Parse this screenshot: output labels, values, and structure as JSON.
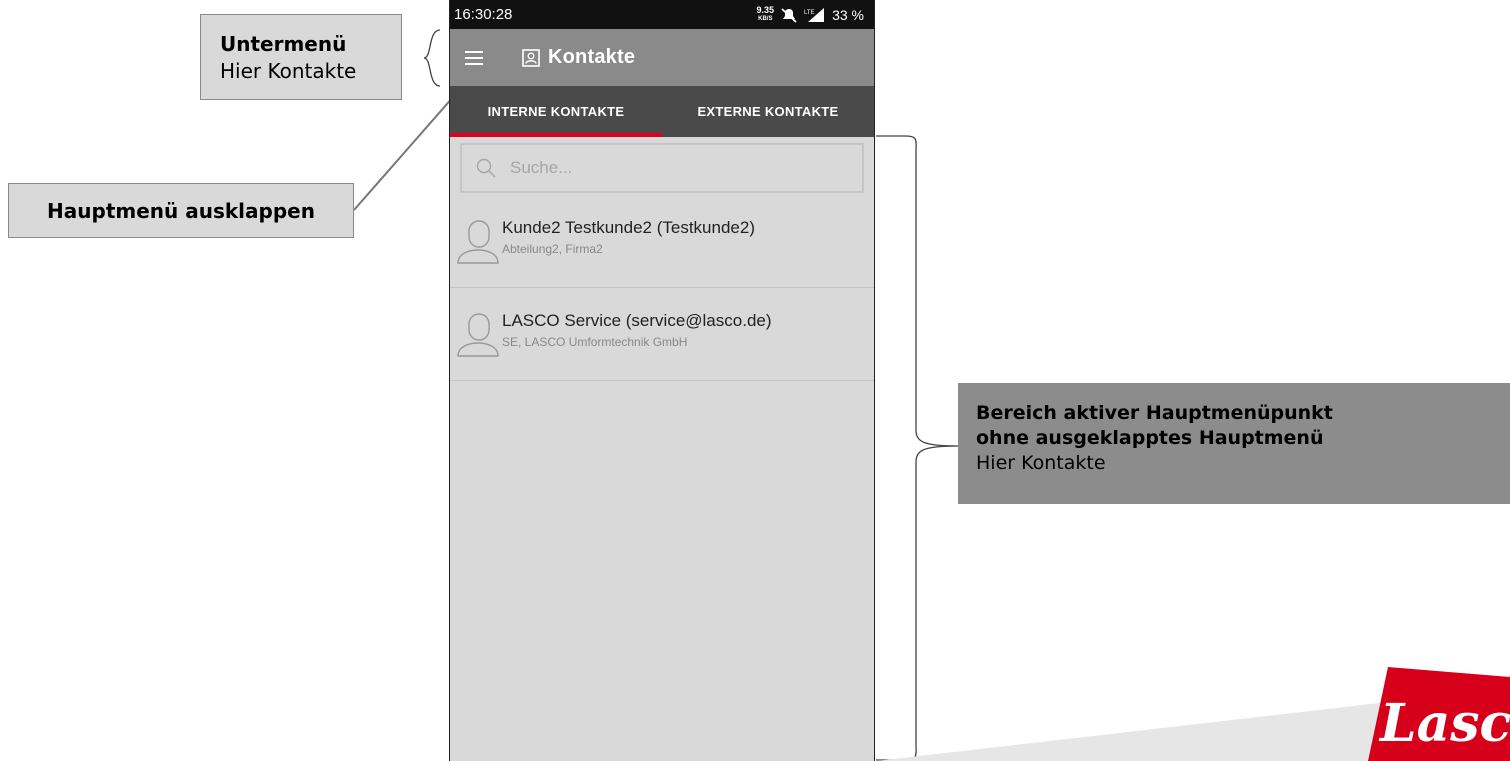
{
  "annotations": {
    "submenu": {
      "title": "Untermenü",
      "subtitle": "Hier Kontakte"
    },
    "mainmenu": {
      "title": "Hauptmenü ausklappen"
    },
    "area": {
      "line1": "Bereich aktiver Hauptmenüpunkt",
      "line2": "ohne ausgeklapptes Hauptmenü",
      "line3": "Hier Kontakte"
    }
  },
  "statusbar": {
    "time": "16:30:28",
    "speed_value": "9.35",
    "speed_unit": "KB/S",
    "battery": "33 %"
  },
  "appbar": {
    "title": "Kontakte",
    "menu_icon": "hamburger-icon",
    "title_icon": "contact-book-icon"
  },
  "tabs": [
    {
      "label": "INTERNE KONTAKTE",
      "active": true
    },
    {
      "label": "EXTERNE KONTAKTE",
      "active": false
    }
  ],
  "search": {
    "placeholder": "Suche..."
  },
  "contacts": [
    {
      "name": "Kunde2 Testkunde2 (Testkunde2)",
      "detail": "Abteilung2, Firma2"
    },
    {
      "name": "LASCO Service (service@lasco.de)",
      "detail": "SE, LASCO Umformtechnik GmbH"
    }
  ],
  "logo": {
    "text": "Lasco"
  },
  "colors": {
    "accent": "#e3001b",
    "appbar": "#8a8a8a",
    "tabbar": "#4a4a4a",
    "content": "#d9d9d9"
  }
}
